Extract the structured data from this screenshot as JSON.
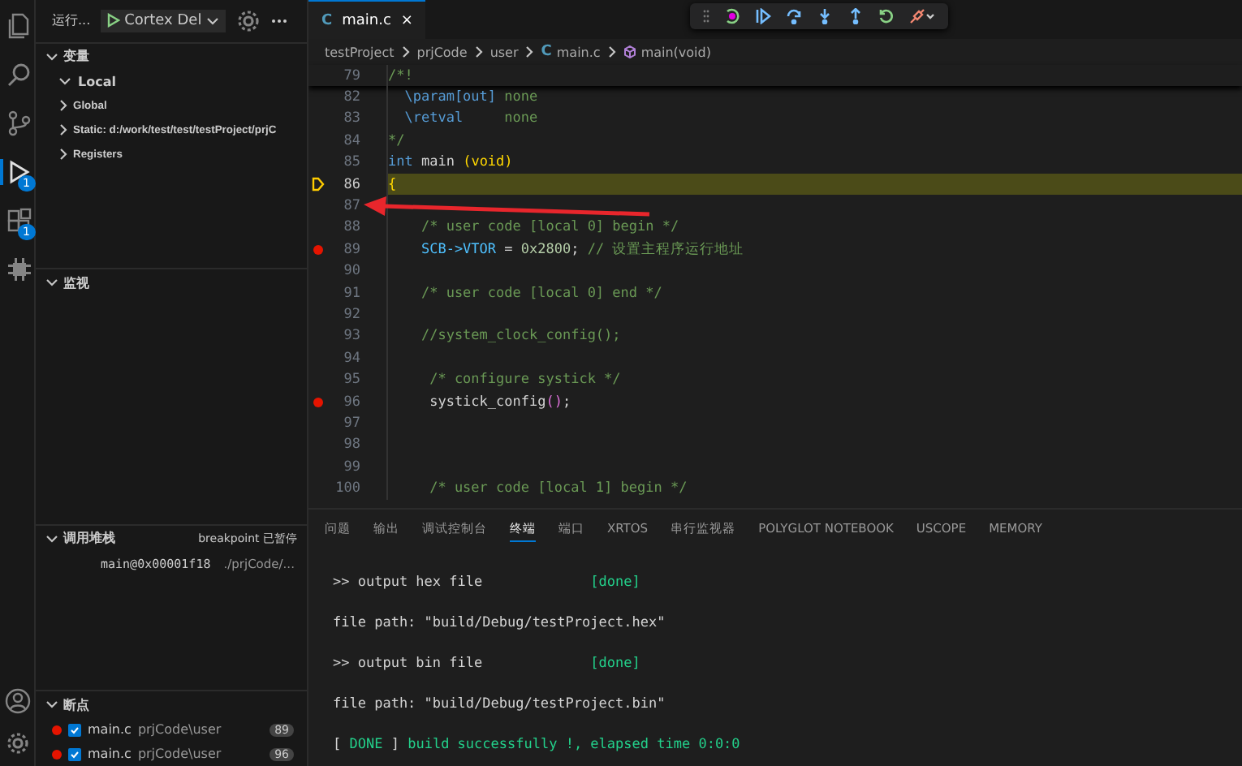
{
  "activity_bar": {
    "items": [
      {
        "kind": "files",
        "selected": false
      },
      {
        "kind": "search",
        "selected": false
      },
      {
        "kind": "source-control",
        "selected": false
      },
      {
        "kind": "debug",
        "selected": true,
        "badge": "1"
      },
      {
        "kind": "extensions",
        "selected": false,
        "badge": "1"
      },
      {
        "kind": "chip",
        "selected": false
      }
    ],
    "bottom": [
      {
        "kind": "account"
      },
      {
        "kind": "settings"
      }
    ]
  },
  "sidebar": {
    "title": "运行...",
    "config": "Cortex Del",
    "variables": {
      "title": "变量",
      "expanded": true,
      "items": [
        {
          "label": "Local",
          "expanded": true
        },
        {
          "label": "Global",
          "expanded": false
        },
        {
          "label": "Static: d:/work/test/test/testProject/prjC",
          "expanded": false
        },
        {
          "label": "Registers",
          "expanded": false
        }
      ]
    },
    "watch": {
      "title": "监视",
      "expanded": true
    },
    "call_stack": {
      "title": "调用堆栈",
      "expanded": true,
      "status": "breakpoint 已暂停",
      "frames": [
        {
          "name": "main@0x00001f18",
          "path": "./prjCode/..."
        }
      ]
    },
    "breakpoints": {
      "title": "断点",
      "expanded": true,
      "items": [
        {
          "file": "main.c",
          "path": "prjCode\\user",
          "line": "89",
          "checked": true
        },
        {
          "file": "main.c",
          "path": "prjCode\\user",
          "line": "96",
          "checked": true
        }
      ]
    }
  },
  "editor": {
    "tabs": [
      {
        "icon": "C",
        "label": "main.c",
        "close": "×",
        "selected": true
      }
    ],
    "breadcrumb": [
      {
        "kind": "folder",
        "label": "testProject"
      },
      {
        "kind": "folder",
        "label": "prjCode"
      },
      {
        "kind": "folder",
        "label": "user"
      },
      {
        "kind": "file",
        "icon": "C",
        "label": "main.c"
      },
      {
        "kind": "symbol",
        "label": "main(void)"
      }
    ],
    "lines": [
      {
        "number": "79",
        "sticky": true,
        "tokens": [
          {
            "kind": "comment",
            "text": "/*!"
          }
        ]
      },
      {
        "number": "82",
        "tokens": [
          {
            "kind": "comment-tag",
            "text": "  \\param[out] "
          },
          {
            "kind": "comment",
            "text": "none"
          }
        ]
      },
      {
        "number": "83",
        "tokens": [
          {
            "kind": "comment-tag",
            "text": "  \\retval     "
          },
          {
            "kind": "comment",
            "text": "none"
          }
        ]
      },
      {
        "number": "84",
        "tokens": [
          {
            "kind": "comment",
            "text": "*/"
          }
        ]
      },
      {
        "number": "85",
        "tokens": [
          {
            "kind": "keyword",
            "text": "int"
          },
          {
            "kind": "plain",
            "text": " main "
          },
          {
            "kind": "paren",
            "text": "(void)"
          }
        ]
      },
      {
        "number": "86",
        "current": true,
        "tokens": [
          {
            "kind": "paren",
            "text": "{"
          }
        ]
      },
      {
        "number": "87"
      },
      {
        "number": "88",
        "tokens": [
          {
            "kind": "comment",
            "text": "    /* user code [local 0] begin */"
          }
        ]
      },
      {
        "number": "89",
        "breakpoint": true,
        "tokens": [
          {
            "kind": "variable",
            "text": "    SCB->VTOR"
          },
          {
            "kind": "plain",
            "text": " = "
          },
          {
            "kind": "number",
            "text": "0x2800"
          },
          {
            "kind": "plain",
            "text": "; "
          },
          {
            "kind": "comment",
            "text": "// 设置主程序运行地址"
          }
        ]
      },
      {
        "number": "90"
      },
      {
        "number": "91",
        "tokens": [
          {
            "kind": "comment",
            "text": "    /* user code [local 0] end */"
          }
        ]
      },
      {
        "number": "92"
      },
      {
        "number": "93",
        "tokens": [
          {
            "kind": "comment",
            "text": "    //system_clock_config();"
          }
        ]
      },
      {
        "number": "94"
      },
      {
        "number": "95",
        "tokens": [
          {
            "kind": "comment",
            "text": "     /* configure systick */"
          }
        ]
      },
      {
        "number": "96",
        "breakpoint": true,
        "tokens": [
          {
            "kind": "plain",
            "text": "     systick_config"
          },
          {
            "kind": "paren2",
            "text": "()"
          },
          {
            "kind": "plain",
            "text": ";"
          }
        ]
      },
      {
        "number": "97"
      },
      {
        "number": "98"
      },
      {
        "number": "99"
      },
      {
        "number": "100",
        "tokens": [
          {
            "kind": "comment",
            "text": "     /* user code [local 1] begin */"
          }
        ]
      }
    ]
  },
  "panel": {
    "tabs": [
      {
        "label": "问题",
        "selected": false
      },
      {
        "label": "输出",
        "selected": false
      },
      {
        "label": "调试控制台",
        "selected": false
      },
      {
        "label": "终端",
        "selected": true
      },
      {
        "label": "端口",
        "selected": false
      },
      {
        "label": "XRTOS",
        "selected": false
      },
      {
        "label": "串行监视器",
        "selected": false
      },
      {
        "label": "POLYGLOT NOTEBOOK",
        "selected": false
      },
      {
        "label": "USCOPE",
        "selected": false
      },
      {
        "label": "MEMORY",
        "selected": false
      }
    ],
    "terminal": [
      [
        {
          "kind": "plain",
          "text": ">> output hex file             "
        },
        {
          "kind": "ok",
          "text": "[done]"
        }
      ],
      [
        {
          "kind": "plain",
          "text": "file path: \"build/Debug/testProject.hex\""
        }
      ],
      [
        {
          "kind": "plain",
          "text": ">> output bin file             "
        },
        {
          "kind": "ok",
          "text": "[done]"
        }
      ],
      [
        {
          "kind": "plain",
          "text": "file path: \"build/Debug/testProject.bin\""
        }
      ],
      [
        {
          "kind": "plain",
          "text": "[ "
        },
        {
          "kind": "ok",
          "text": "DONE"
        },
        {
          "kind": "plain",
          "text": " ] "
        },
        {
          "kind": "ok",
          "text": "build successfully !, elapsed time 0:0:0"
        }
      ]
    ]
  }
}
